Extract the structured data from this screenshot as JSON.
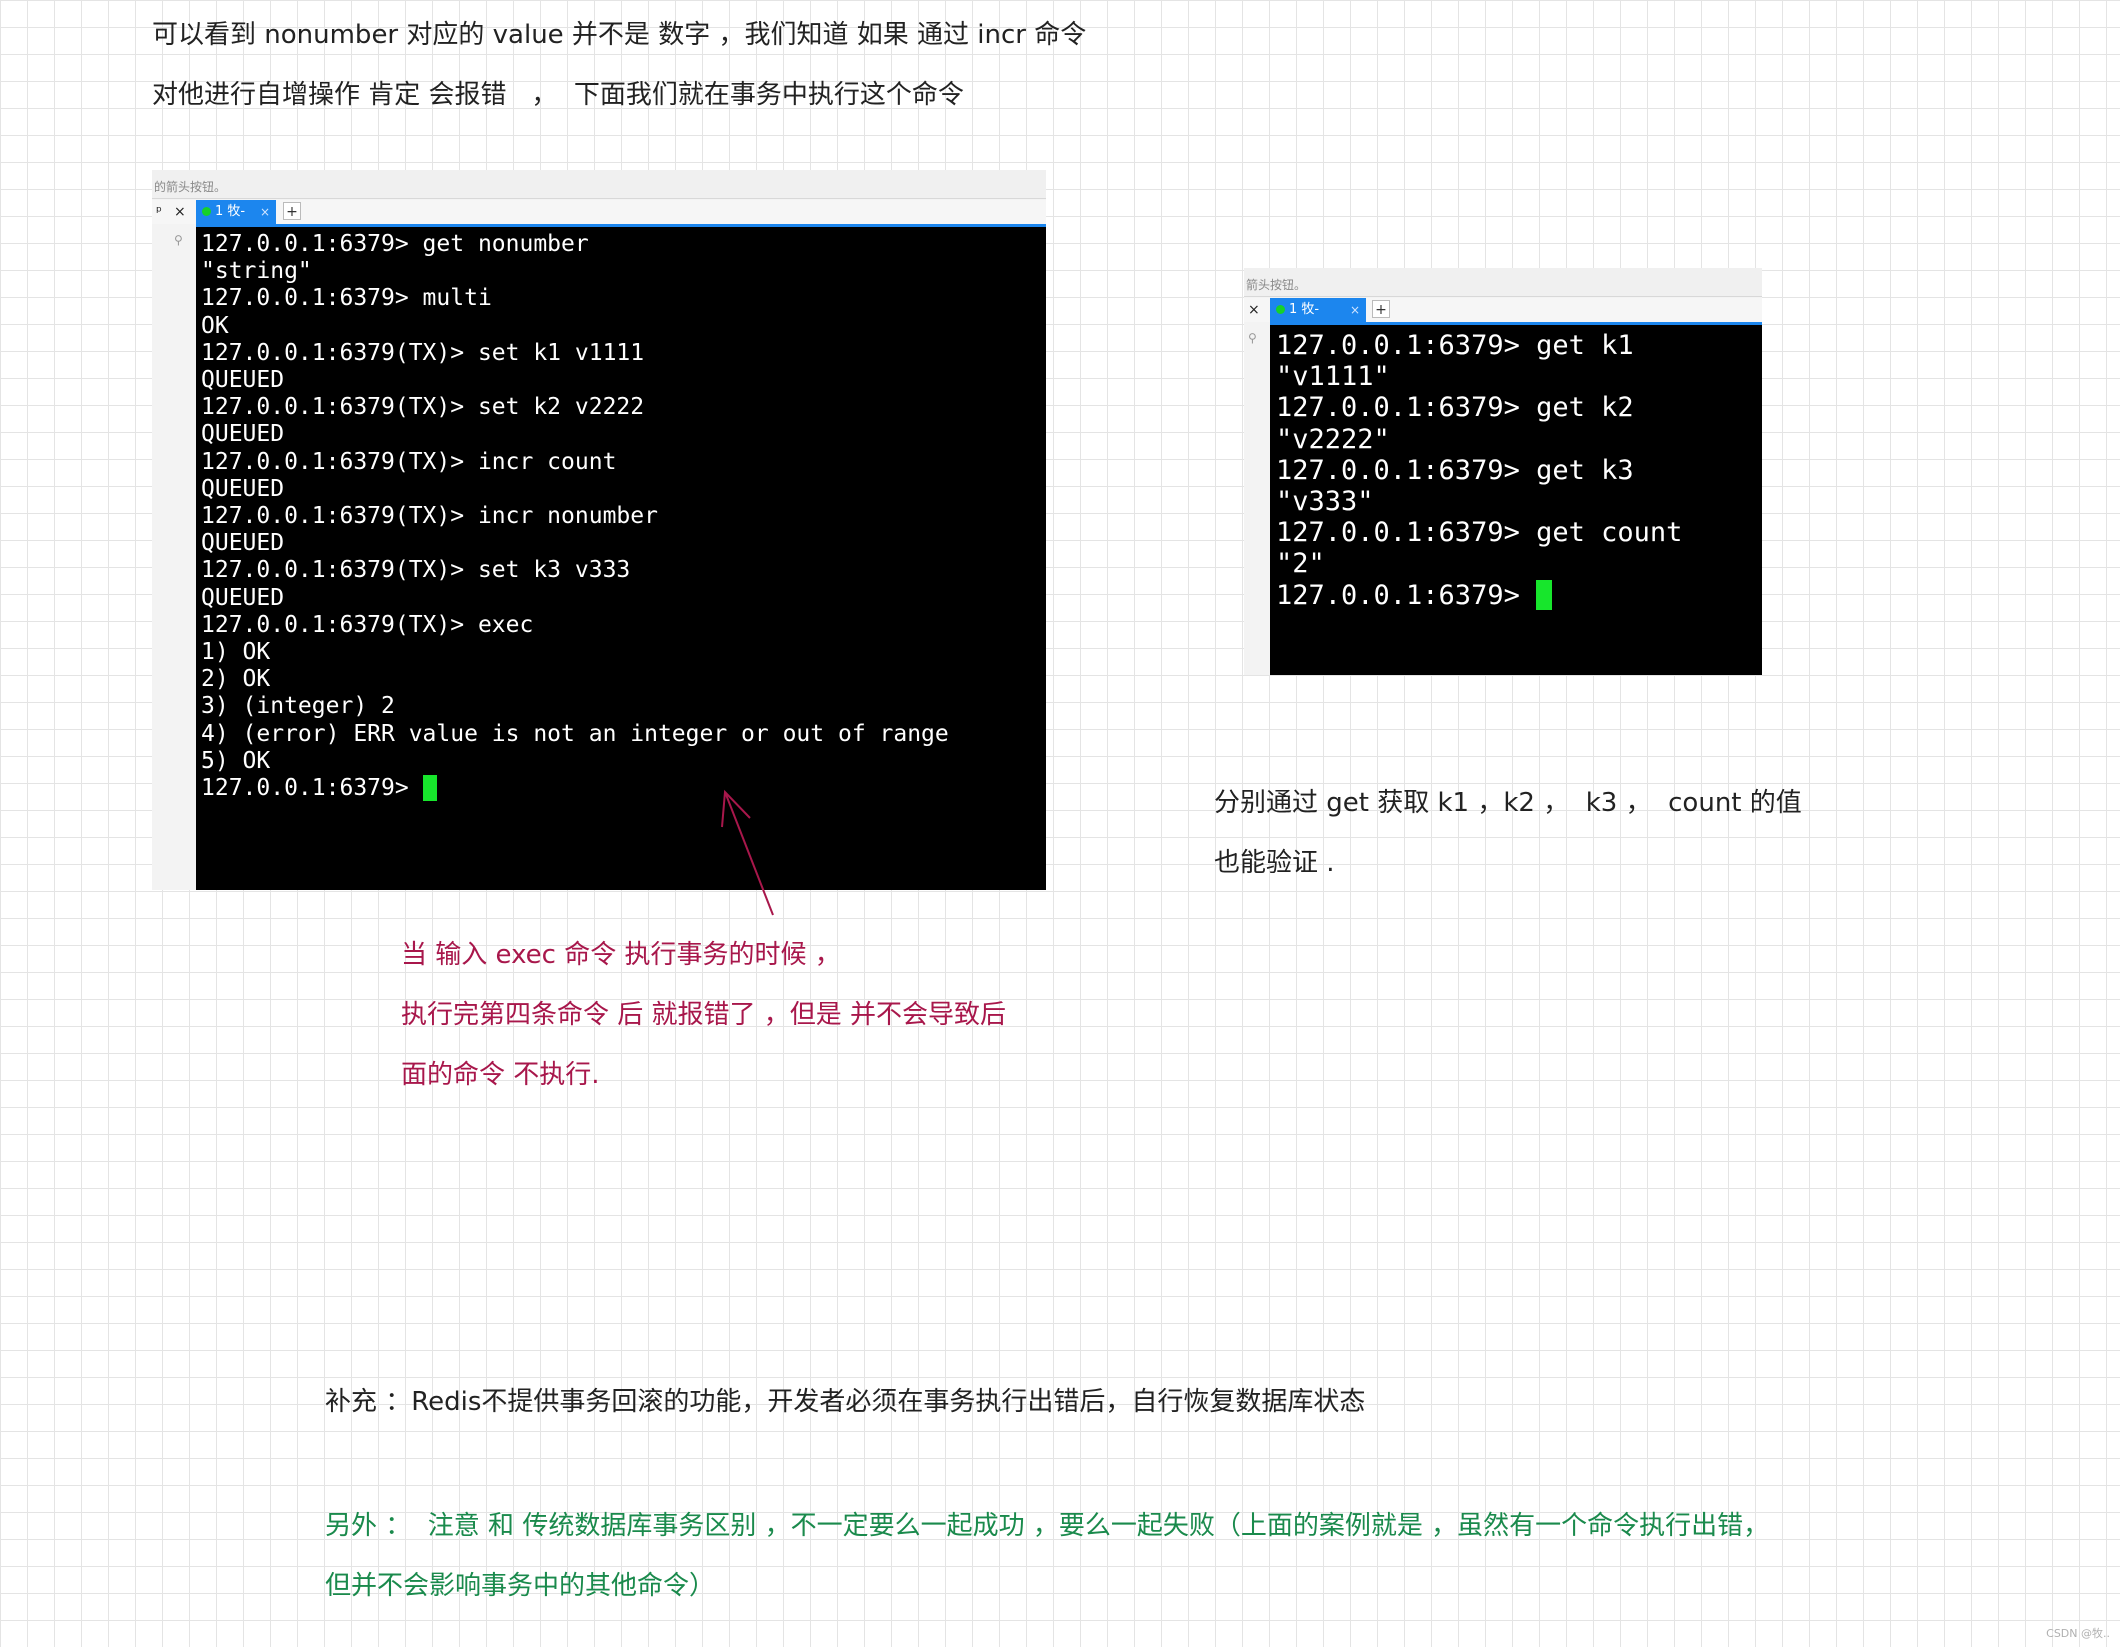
{
  "notes": {
    "intro_line1": "可以看到 nonumber 对应的 value 并不是 数字 ，我们知道 如果 通过 incr 命令",
    "intro_line2": "对他进行自增操作 肯定 会报错   ，  下面我们就在事务中执行这个命令",
    "right_line1": "分别通过 get 获取 k1 ，k2 ，  k3 ，  count 的值",
    "right_line2": "也能验证 .",
    "annotation_line1": "当 输入 exec 命令 执行事务的时候 ，",
    "annotation_line2": "执行完第四条命令 后 就报错了 ，但是 并不会导致后",
    "annotation_line3": "面的命令 不执行.",
    "supplement": "补充 ：Redis不提供事务回滚的功能，开发者必须在事务执行出错后，自行恢复数据库状态",
    "extra_line1": "另外 ：  注意 和 传统数据库事务区别 ，不一定要么一起成功 ，要么一起失败（上面的案例就是 ，虽然有一个命令执行出错，",
    "extra_line2": "但并不会影响事务中的其他命令）"
  },
  "terminal_left": {
    "hint": "的箭头按钮。",
    "pin_icon": "pin-icon",
    "close_label": "×",
    "tab_label": "1 牧-",
    "tab_close": "×",
    "tab_add": "+",
    "lines": [
      "127.0.0.1:6379> get nonumber",
      "\"string\"",
      "127.0.0.1:6379> multi",
      "OK",
      "127.0.0.1:6379(TX)> set k1 v1111",
      "QUEUED",
      "127.0.0.1:6379(TX)> set k2 v2222",
      "QUEUED",
      "127.0.0.1:6379(TX)> incr count",
      "QUEUED",
      "127.0.0.1:6379(TX)> incr nonumber",
      "QUEUED",
      "127.0.0.1:6379(TX)> set k3 v333",
      "QUEUED",
      "127.0.0.1:6379(TX)> exec",
      "1) OK",
      "2) OK",
      "3) (integer) 2",
      "4) (error) ERR value is not an integer or out of range",
      "5) OK"
    ],
    "prompt": "127.0.0.1:6379> "
  },
  "terminal_right": {
    "hint": "箭头按钮。",
    "close_label": "×",
    "tab_label": "1 牧-",
    "tab_close": "×",
    "tab_add": "+",
    "lines": [
      "127.0.0.1:6379> get k1",
      "\"v1111\"",
      "127.0.0.1:6379> get k2",
      "\"v2222\"",
      "127.0.0.1:6379> get k3",
      "\"v333\"",
      "127.0.0.1:6379> get count",
      "\"2\""
    ],
    "prompt": "127.0.0.1:6379> "
  },
  "watermark": "CSDN @牧..",
  "colors": {
    "annotation": "#a8174b",
    "note_green": "#1a8a4c",
    "cursor": "#17e62c",
    "tab_active": "#1c86ee"
  }
}
